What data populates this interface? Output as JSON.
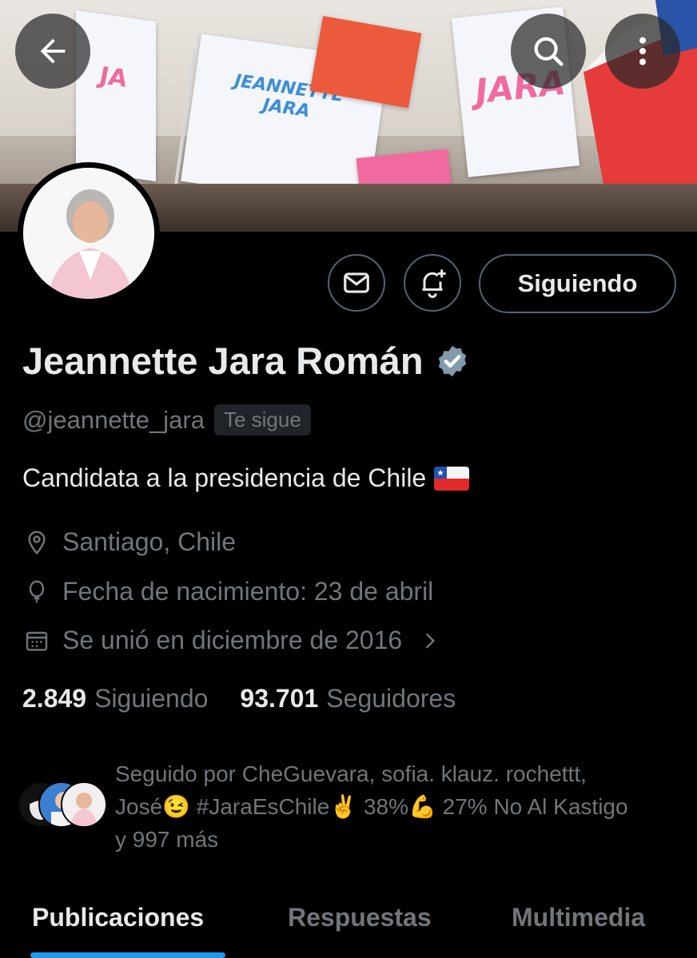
{
  "header": {
    "back_icon": "arrow-left-icon",
    "search_icon": "search-icon",
    "more_icon": "more-vertical-icon",
    "banner_flags": [
      "JEANNETTE JARA",
      "JEANNETTE JARA"
    ]
  },
  "profile": {
    "follow_button_label": "Siguiendo",
    "message_icon": "mail-icon",
    "notify_icon": "bell-plus-icon",
    "name": "Jeannette Jara Román",
    "verified": true,
    "handle": "@jeannette_jara",
    "follows_you_badge": "Te sigue",
    "bio": "Candidata a la presidencia de Chile",
    "location": "Santiago, Chile",
    "birthday": "Fecha de nacimiento: 23 de abril",
    "joined": "Se unió en diciembre de 2016"
  },
  "stats": {
    "following_count": "2.849",
    "following_label": "Siguiendo",
    "followers_count": "93.701",
    "followers_label": "Seguidores"
  },
  "followed_by": {
    "line1": "Seguido por CheGuevara, sofia. klauz. rochettt,",
    "line2": "José😉 #JaraEsChile✌️ 38%💪 27% No Al Kastigo",
    "line3": "y 997 más"
  },
  "tabs": [
    {
      "label": "Publicaciones",
      "active": true
    },
    {
      "label": "Respuestas",
      "active": false
    },
    {
      "label": "Multimedia",
      "active": false
    }
  ],
  "colors": {
    "accent": "#1d9bf0",
    "secondary_text": "#71767b",
    "border": "#536471",
    "background": "#000000"
  }
}
